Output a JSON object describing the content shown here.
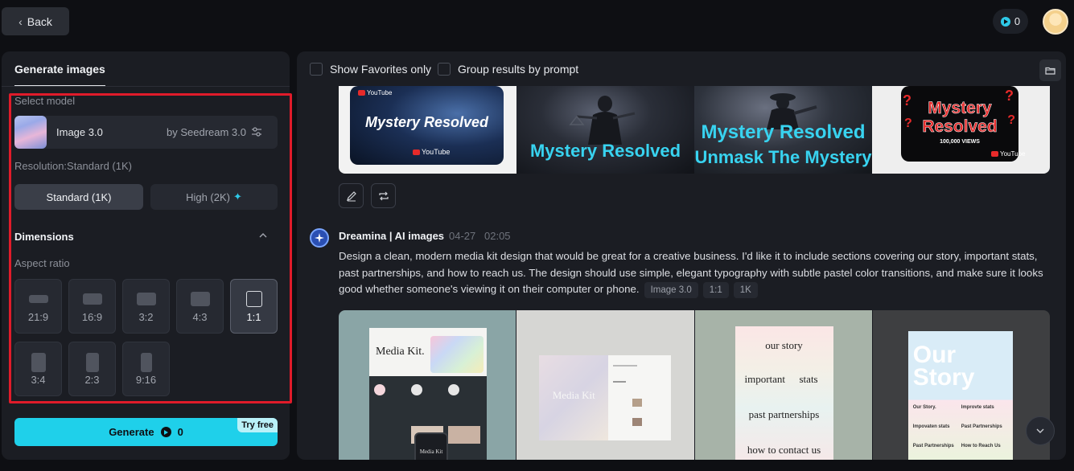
{
  "header": {
    "back_label": "Back",
    "credits": "0"
  },
  "left": {
    "tab": "Generate images",
    "select_model_label": "Select model",
    "model_name": "Image 3.0",
    "model_by": "by Seedream 3.0",
    "resolution_label": "Resolution:Standard (1K)",
    "res_standard": "Standard (1K)",
    "res_high": "High (2K)",
    "dimensions_title": "Dimensions",
    "aspect_label": "Aspect ratio",
    "ratios": [
      "21:9",
      "16:9",
      "3:2",
      "4:3",
      "1:1",
      "3:4",
      "2:3",
      "9:16"
    ],
    "selected_ratio": "1:1",
    "generate_label": "Generate",
    "generate_credits": "0",
    "try_free": "Try free"
  },
  "right": {
    "show_favorites": "Show Favorites only",
    "group_by_prompt": "Group results by prompt",
    "top_images": {
      "t1": "Mystery Resolved",
      "t2": "Mystery Resolved",
      "t3a": "Mystery Resolved",
      "t3b": "Unmask The Mystery",
      "t4": "Mystery Resolved",
      "t4_views": "100,000 VIEWS",
      "youtube": "YouTube"
    },
    "agent": "Dreamina | AI images",
    "date": "04-27",
    "time": "02:05",
    "prompt": "Design a clean, modern media kit design that would be great for a creative business. I'd like it to include sections covering our story, important stats, past partnerships, and how to reach us. The design should use simple, elegant typography with subtle pastel color transitions, and make sure it looks good whether someone's viewing it on their computer or phone.",
    "chips": [
      "Image 3.0",
      "1:1",
      "1K"
    ],
    "bottom_images": {
      "b1_title": "Media Kit.",
      "b1_phone": "Media Kit",
      "b2_title": "Media Kit",
      "b3_lines": [
        "our story",
        "important",
        "stats",
        "past partnerships",
        "how to contact us"
      ],
      "b4_title": "Our Story",
      "b4_items": [
        "Our Story.",
        "Improvte stats",
        "Impovaten stats",
        "Past Partnerships",
        "Past Partnerships",
        "How to Reach Us"
      ]
    }
  },
  "colors": {
    "accent": "#1fd0ea",
    "highlight": "#e01b2a",
    "background": "#0e0f13",
    "panel": "#1b1d23"
  }
}
